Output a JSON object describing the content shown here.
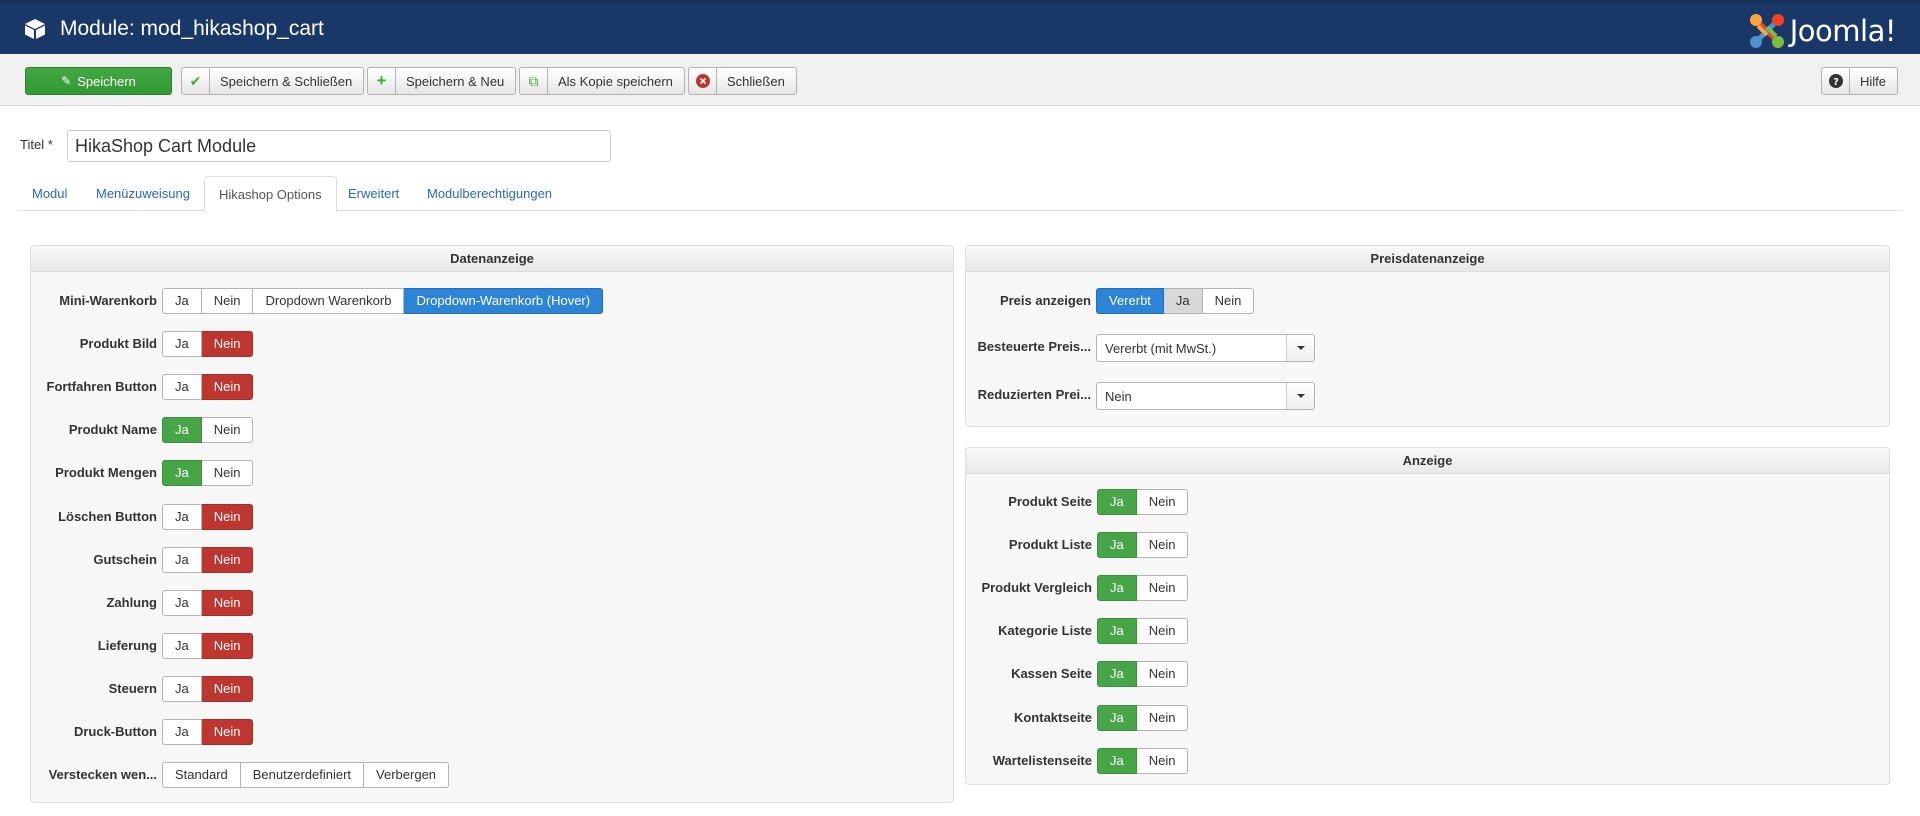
{
  "header": {
    "title": "Module: mod_hikashop_cart",
    "logo_text": "Joomla!",
    "icon": "cube-icon"
  },
  "toolbar": {
    "save": "Speichern",
    "save_close": "Speichern & Schließen",
    "save_new": "Speichern & Neu",
    "save_copy": "Als Kopie speichern",
    "close": "Schließen",
    "help": "Hilfe"
  },
  "form": {
    "title_label": "Titel *",
    "title_value": "HikaShop Cart Module"
  },
  "tabs": [
    {
      "label": "Modul"
    },
    {
      "label": "Menüzuweisung"
    },
    {
      "label": "Hikashop Options",
      "active": true
    },
    {
      "label": "Erweitert"
    },
    {
      "label": "Modulberechtigungen"
    }
  ],
  "datenanzeige": {
    "title": "Datenanzeige",
    "rows": [
      {
        "label": "Mini-Warenkorb",
        "options": [
          "Ja",
          "Nein",
          "Dropdown Warenkorb",
          "Dropdown-Warenkorb (Hover)"
        ],
        "selected": "Dropdown-Warenkorb (Hover)"
      },
      {
        "label": "Produkt Bild",
        "options": [
          "Ja",
          "Nein"
        ],
        "selected": "Nein"
      },
      {
        "label": "Fortfahren Button",
        "options": [
          "Ja",
          "Nein"
        ],
        "selected": "Nein"
      },
      {
        "label": "Produkt Name",
        "options": [
          "Ja",
          "Nein"
        ],
        "selected": "Ja"
      },
      {
        "label": "Produkt Mengen",
        "options": [
          "Ja",
          "Nein"
        ],
        "selected": "Ja"
      },
      {
        "label": "Löschen Button",
        "options": [
          "Ja",
          "Nein"
        ],
        "selected": "Nein"
      },
      {
        "label": "Gutschein",
        "options": [
          "Ja",
          "Nein"
        ],
        "selected": "Nein"
      },
      {
        "label": "Zahlung",
        "options": [
          "Ja",
          "Nein"
        ],
        "selected": "Nein"
      },
      {
        "label": "Lieferung",
        "options": [
          "Ja",
          "Nein"
        ],
        "selected": "Nein"
      },
      {
        "label": "Steuern",
        "options": [
          "Ja",
          "Nein"
        ],
        "selected": "Nein"
      },
      {
        "label": "Druck-Button",
        "options": [
          "Ja",
          "Nein"
        ],
        "selected": "Nein"
      },
      {
        "label": "Verstecken wen...",
        "options": [
          "Standard",
          "Benutzerdefiniert",
          "Verbergen"
        ],
        "selected": ""
      }
    ]
  },
  "preisdatenanzeige": {
    "title": "Preisdatenanzeige",
    "preis_anzeigen": {
      "label": "Preis anzeigen",
      "options": [
        "Vererbt",
        "Ja",
        "Nein"
      ],
      "selected": "Vererbt",
      "hover": "Ja"
    },
    "besteuerte": {
      "label": "Besteuerte Preis...",
      "value": "Vererbt (mit MwSt.)"
    },
    "reduzierten": {
      "label": "Reduzierten Prei...",
      "value": "Nein"
    }
  },
  "anzeige": {
    "title": "Anzeige",
    "rows": [
      {
        "label": "Produkt Seite",
        "options": [
          "Ja",
          "Nein"
        ],
        "selected": "Ja"
      },
      {
        "label": "Produkt Liste",
        "options": [
          "Ja",
          "Nein"
        ],
        "selected": "Ja"
      },
      {
        "label": "Produkt Vergleich",
        "options": [
          "Ja",
          "Nein"
        ],
        "selected": "Ja"
      },
      {
        "label": "Kategorie Liste",
        "options": [
          "Ja",
          "Nein"
        ],
        "selected": "Ja"
      },
      {
        "label": "Kassen Seite",
        "options": [
          "Ja",
          "Nein"
        ],
        "selected": "Ja"
      },
      {
        "label": "Kontaktseite",
        "options": [
          "Ja",
          "Nein"
        ],
        "selected": "Ja"
      },
      {
        "label": "Wartelistenseite",
        "options": [
          "Ja",
          "Nein"
        ],
        "selected": "Ja"
      }
    ]
  },
  "colors": {
    "header_bg": "#1a3867",
    "yes_green": "#46a546",
    "no_red": "#bd362f",
    "active_blue": "#2d84d6",
    "tab_link": "#2a69b8"
  }
}
